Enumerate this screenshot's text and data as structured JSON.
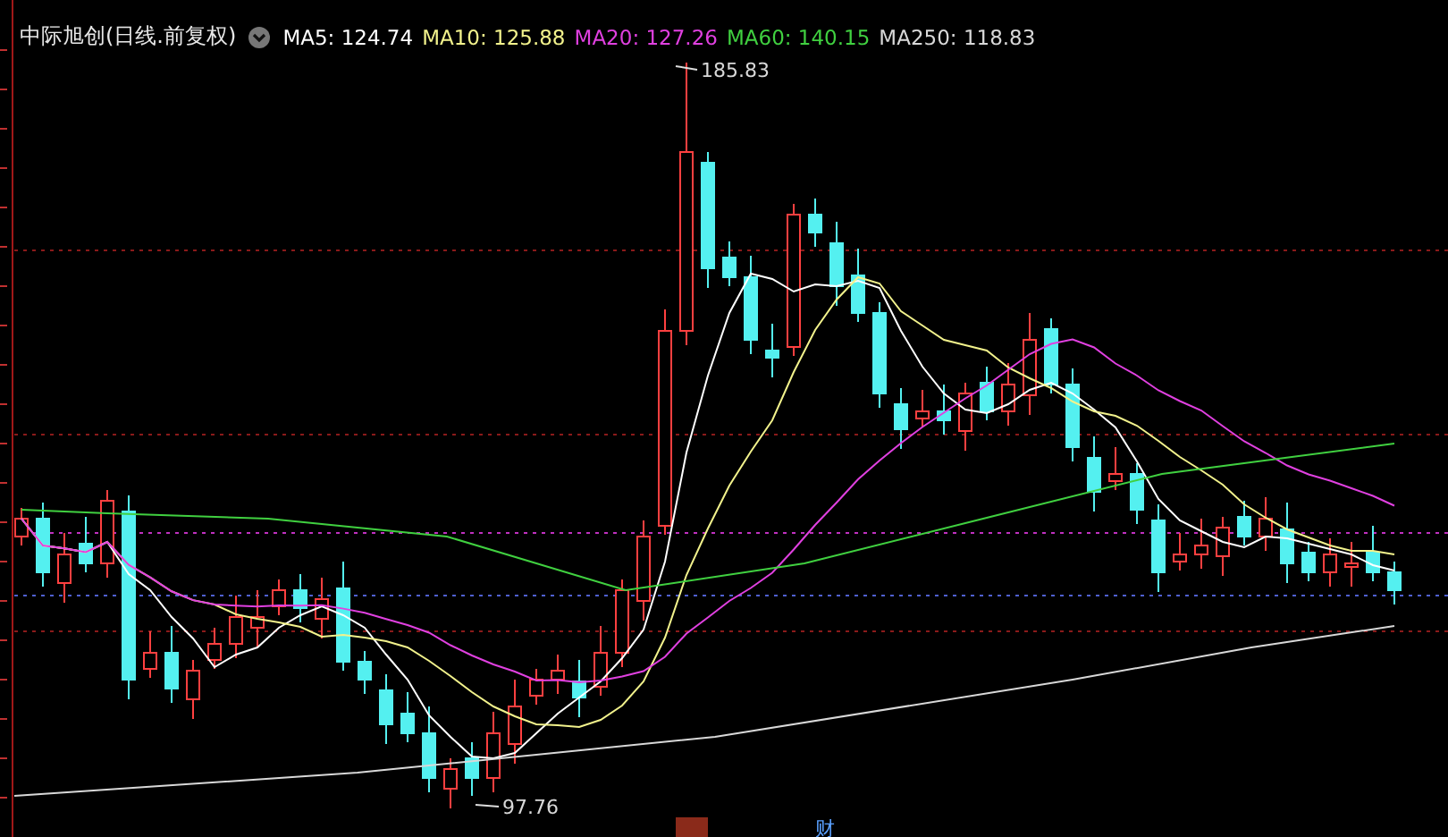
{
  "chart": {
    "title": "中际旭创(日线.前复权)",
    "ma_legend": [
      {
        "label": "MA5: 124.74",
        "color": "#ffffff"
      },
      {
        "label": "MA10: 125.88",
        "color": "#f2f28c"
      },
      {
        "label": "MA20: 127.26",
        "color": "#e040e0"
      },
      {
        "label": "MA60: 140.15",
        "color": "#40d040"
      },
      {
        "label": "MA250: 118.83",
        "color": "#d8d8d8"
      }
    ],
    "high_label": "185.83",
    "low_label": "97.76"
  },
  "bottom_markers": [
    {
      "kind": "icon"
    },
    {
      "kind": "text",
      "text": "财"
    }
  ]
}
